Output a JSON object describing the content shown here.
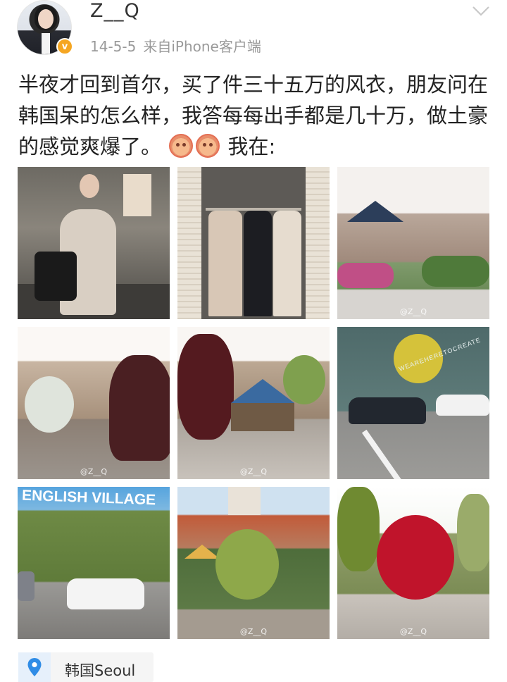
{
  "post": {
    "username": "Z__Q",
    "date": "14-5-5",
    "source": "来自iPhone客户端",
    "verified_badge": "v",
    "text_main": "半夜才回到首尔，买了件三十五万的风衣，朋友问在韩国呆的怎么样，我答每每出手都是几十万，做土豪的感觉爽爆了。",
    "text_tail": "我在:",
    "location": "韩国Seoul"
  },
  "photos": {
    "watermark": "@Z__Q",
    "p6_sign": "WEAREHERETOCREATE",
    "p7_sign": "ENGLISH VILLAGE"
  },
  "icons": {
    "chevron": "chevron-down-icon",
    "location": "location-pin-icon",
    "emoji": "face-emoji-icon"
  },
  "colors": {
    "badge": "#f5a623",
    "location_pin": "#2f8ce6",
    "meta_text": "#9a9a9a"
  }
}
